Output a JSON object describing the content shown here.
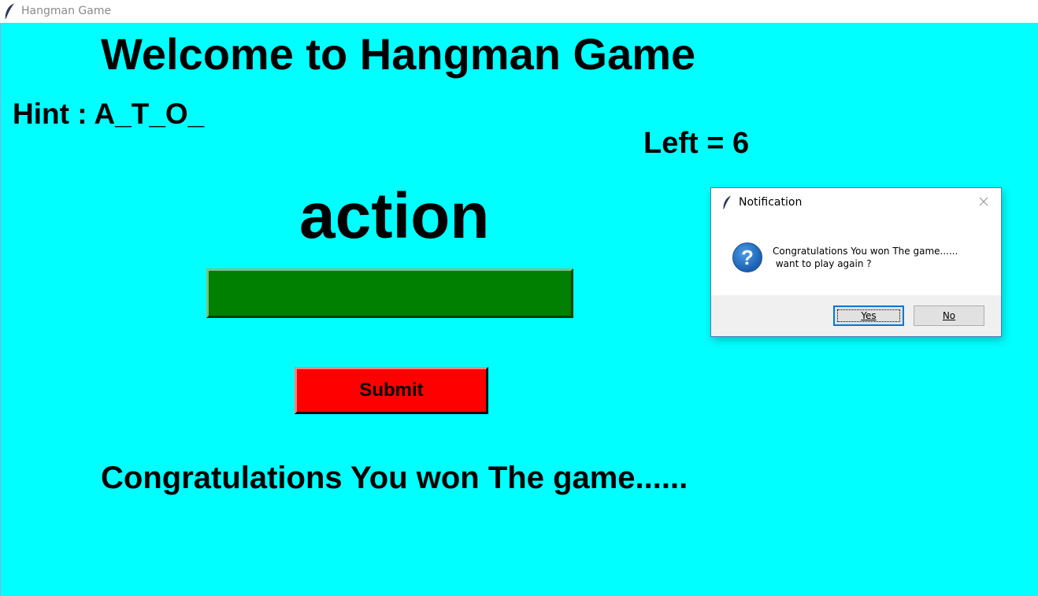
{
  "window": {
    "title": "Hangman Game",
    "icon": "feather-icon"
  },
  "game": {
    "heading": "Welcome to Hangman Game",
    "hint": "Hint : A_T_O_",
    "left": "Left = 6",
    "word": "action",
    "input_value": "",
    "submit_label": "Submit",
    "message": "Congratulations You won The game......"
  },
  "dialog": {
    "title": "Notification",
    "icon": "question-icon",
    "message": "Congratulations You won The game......\n want to play again ?",
    "yes_label": "Yes",
    "no_label": "No"
  },
  "colors": {
    "background": "#00ffff",
    "input": "#008000",
    "submit": "#ff0000"
  }
}
